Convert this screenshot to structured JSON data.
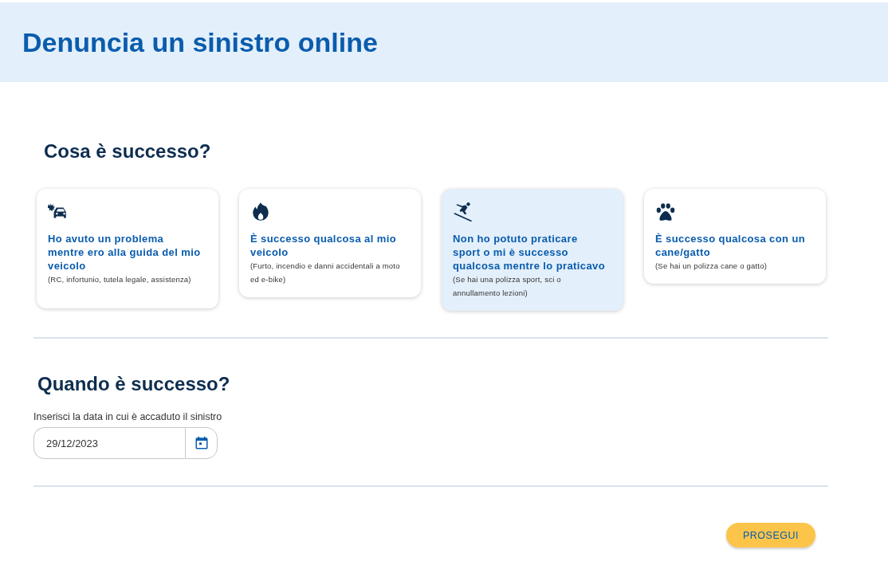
{
  "header": {
    "title": "Denuncia un sinistro online"
  },
  "what": {
    "heading": "Cosa è successo?",
    "cards": [
      {
        "kind": "car",
        "title": "Ho avuto un problema mentre ero alla guida del mio veicolo",
        "description": "(RC, infortunio, tutela legale, assistenza)",
        "selected": false
      },
      {
        "kind": "fire",
        "title": "È successo qualcosa al mio veicolo",
        "description": "(Furto, incendio e danni accidentali a moto ed e-bike)",
        "selected": false
      },
      {
        "kind": "ski",
        "title": "Non ho potuto praticare sport o mi è successo qualcosa mentre lo praticavo",
        "description": "(Se hai una polizza sport, sci o annullamento lezioni)",
        "selected": true
      },
      {
        "kind": "paw",
        "title": "È successo qualcosa con un cane/gatto",
        "description": "(Se hai un polizza cane o gatto)",
        "selected": false
      }
    ]
  },
  "when": {
    "heading": "Quando è successo?",
    "label": "Inserisci la data in cui è accaduto il sinistro",
    "value": "29/12/2023"
  },
  "button": "PROSEGUI"
}
